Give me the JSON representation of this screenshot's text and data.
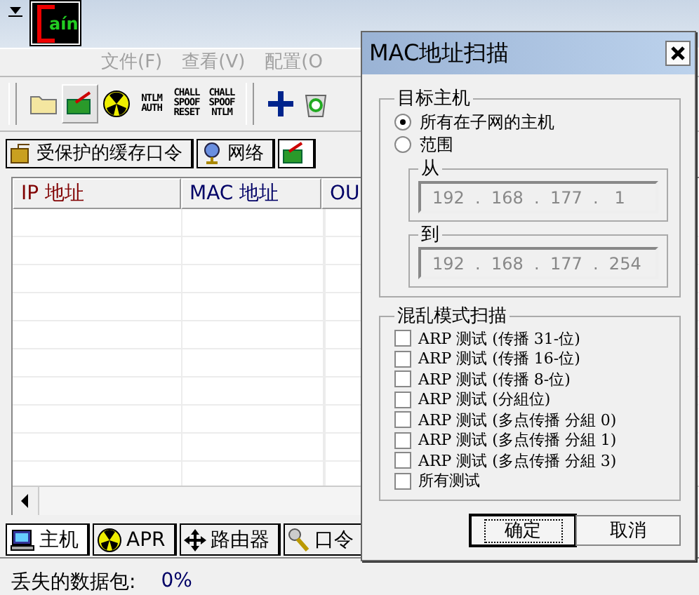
{
  "app": {
    "logo": "aín"
  },
  "menu": [
    "文件(F)",
    "查看(V)",
    "配置(O"
  ],
  "toolbar": [
    {
      "kind": "folder",
      "selected": false
    },
    {
      "kind": "card",
      "selected": true
    },
    {
      "kind": "hazard",
      "selected": false
    },
    {
      "kind": "text",
      "lines": [
        "NTLM",
        "AUTH"
      ],
      "selected": false
    },
    {
      "kind": "text",
      "lines": [
        "CHALL",
        "SPOOF",
        "RESET"
      ],
      "selected": false
    },
    {
      "kind": "text",
      "lines": [
        "CHALL",
        "SPOOF",
        "NTLM"
      ],
      "selected": false
    },
    {
      "kind": "plus",
      "selected": false
    },
    {
      "kind": "recycle",
      "selected": false
    }
  ],
  "top_tabs": [
    {
      "label": "受保护的缓存口令",
      "kind": "cache",
      "selected": false
    },
    {
      "label": "网络",
      "kind": "globe",
      "selected": false
    },
    {
      "kind": "card",
      "selected": true
    }
  ],
  "table": {
    "columns": [
      "IP 地址",
      "MAC 地址",
      "OU"
    ]
  },
  "bottom_tabs": [
    {
      "label": "主机",
      "kind": "pc",
      "selected": true
    },
    {
      "label": "APR",
      "kind": "hazard",
      "selected": false
    },
    {
      "label": "路由器",
      "kind": "move",
      "selected": false
    },
    {
      "label": "口令",
      "kind": "key",
      "selected": false
    }
  ],
  "status_bar": {
    "label": "丢失的数据包:",
    "value": "0%"
  },
  "dialog": {
    "title": "MAC地址扫描",
    "target": {
      "title": "目标主机",
      "options": [
        {
          "label": "所有在子网的主机",
          "selected": true
        },
        {
          "label": "范围",
          "selected": false
        }
      ],
      "from": {
        "title": "从",
        "value": "192  .  168  .  177  .   1",
        "disabled": true
      },
      "to": {
        "title": "到",
        "value": "192  .  168  .  177  .  254",
        "disabled": true
      }
    },
    "promisc": {
      "title": "混乱模式扫描",
      "tests": [
        {
          "label": "ARP 测试 (传播 31-位)",
          "checked": false
        },
        {
          "label": "ARP 测试 (传播 16-位)",
          "checked": false
        },
        {
          "label": "ARP 测试 (传播 8-位)",
          "checked": false
        },
        {
          "label": "ARP 测试 (分組位)",
          "checked": false
        },
        {
          "label": "ARP 测试 (多点传播 分組 0)",
          "checked": false
        },
        {
          "label": "ARP 测试 (多点传播 分組 1)",
          "checked": false
        },
        {
          "label": "ARP 测试 (多点传播 分組 3)",
          "checked": false
        },
        {
          "label": "所有测试",
          "checked": false
        }
      ]
    },
    "buttons": [
      {
        "label": "确定",
        "selected": true
      },
      {
        "label": "取消",
        "selected": false
      }
    ]
  }
}
